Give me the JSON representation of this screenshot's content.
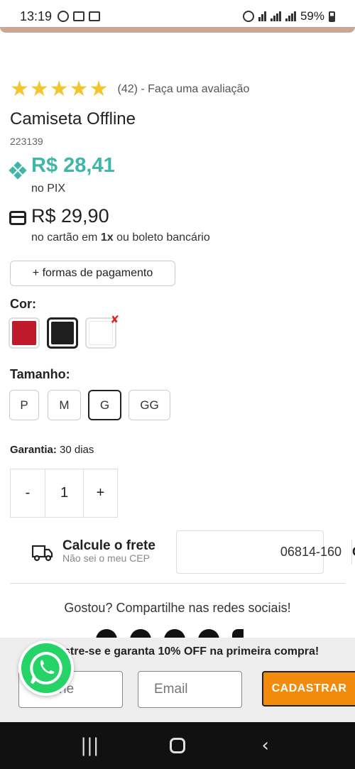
{
  "status_bar": {
    "time": "13:19",
    "battery": "59%"
  },
  "product": {
    "rating_stars": "★★★★★",
    "rating_text": "(42) - Faça uma avaliação",
    "title": "Camiseta Offline",
    "sku": "223139",
    "pix_price": "R$ 28,41",
    "pix_label": "no PIX",
    "card_price": "R$ 29,90",
    "card_label_pre": "no cartão em ",
    "card_label_bold": "1x",
    "card_label_post": " ou boleto bancário",
    "payment_button": "+ formas de pagamento"
  },
  "color": {
    "label": "Cor:",
    "options": [
      {
        "name": "red",
        "hex": "#c0192b"
      },
      {
        "name": "black",
        "hex": "#1e1e1e",
        "selected": true
      },
      {
        "name": "white",
        "hex": "#ffffff",
        "unavailable": true
      }
    ],
    "unavailable_mark": "✘"
  },
  "size": {
    "label": "Tamanho:",
    "options": [
      "P",
      "M",
      "G",
      "GG"
    ],
    "selected": "G"
  },
  "warranty": {
    "label": "Garantia:",
    "value": " 30 dias"
  },
  "quantity": {
    "minus": "-",
    "value": "1",
    "plus": "+"
  },
  "shipping": {
    "title": "Calcule o frete",
    "link": "Não sei o meu CEP",
    "cep_value": "06814-160",
    "ok_label": "OK"
  },
  "share": {
    "text": "Gostou? Compartilhe nas redes sociais!"
  },
  "newsletter": {
    "text": "stre-se e garanta 10% OFF na primeira compra!",
    "name_placeholder": "ne",
    "email_placeholder": "Email",
    "button": "CADASTRAR"
  },
  "nav": {
    "recent": "|||",
    "back": "‹"
  },
  "colors": {
    "accent_teal": "#3fb7a8",
    "star": "#f2c62d",
    "cta_orange": "#f28b0c",
    "whatsapp": "#25d366"
  }
}
